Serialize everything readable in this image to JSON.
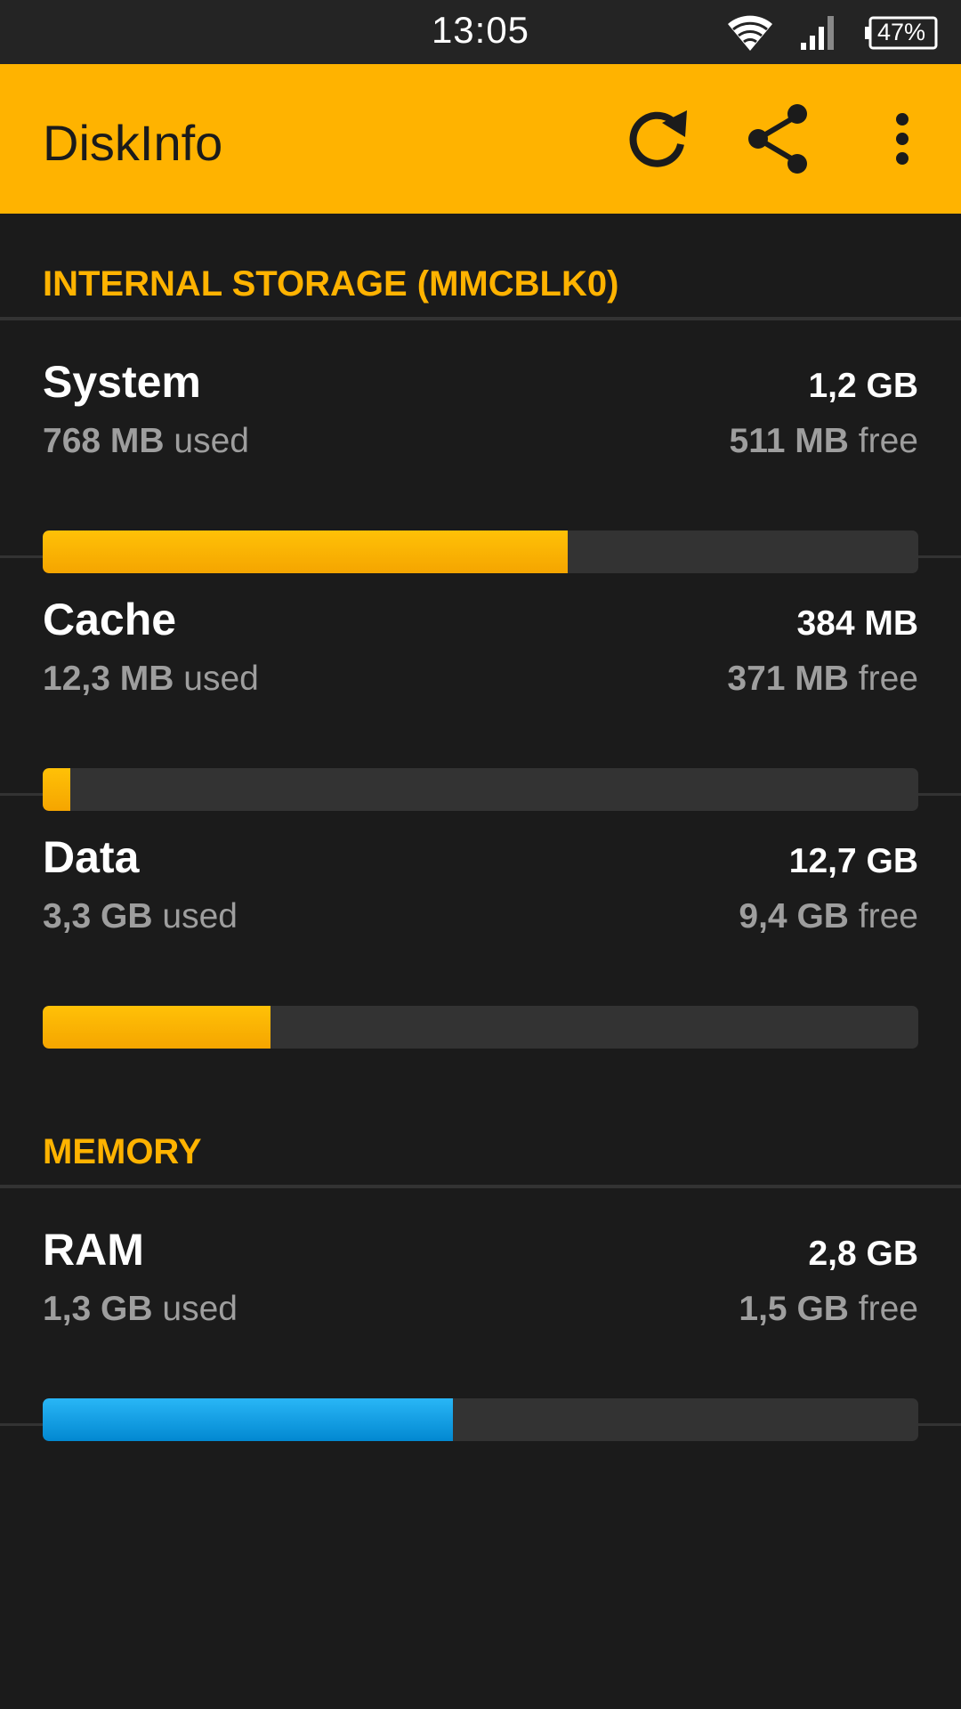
{
  "status_bar": {
    "time": "13:05",
    "battery": "47%",
    "icons": [
      "wifi-icon",
      "cell-signal-icon",
      "battery-icon"
    ]
  },
  "app_bar": {
    "title": "DiskInfo",
    "actions": [
      "refresh-icon",
      "share-icon",
      "more-vert-icon"
    ],
    "background": "#ffb300"
  },
  "sections": {
    "internal": {
      "title": "INTERNAL STORAGE (MMCBLK0)",
      "items": [
        {
          "name": "System",
          "total": "1,2 GB",
          "used_value": "768 MB",
          "used_label": "used",
          "free_value": "511 MB",
          "free_label": "free",
          "used_fraction": 0.6
        },
        {
          "name": "Cache",
          "total": "384 MB",
          "used_value": "12,3 MB",
          "used_label": "used",
          "free_value": "371 MB",
          "free_label": "free",
          "used_fraction": 0.032
        },
        {
          "name": "Data",
          "total": "12,7 GB",
          "used_value": "3,3 GB",
          "used_label": "used",
          "free_value": "9,4 GB",
          "free_label": "free",
          "used_fraction": 0.26
        }
      ]
    },
    "memory": {
      "title": "MEMORY",
      "items": [
        {
          "name": "RAM",
          "total": "2,8 GB",
          "used_value": "1,3 GB",
          "used_label": "used",
          "free_value": "1,5 GB",
          "free_label": "free",
          "used_fraction": 0.468
        }
      ]
    }
  },
  "colors": {
    "accent": "#ffb300",
    "storage_bar": "#ffb300",
    "memory_bar": "#1ea3dc",
    "background": "#1b1b1b"
  }
}
